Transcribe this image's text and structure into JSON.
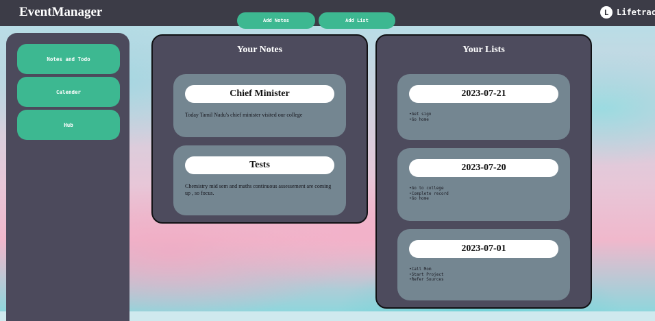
{
  "app": {
    "brand": "EventManager",
    "logo_mark": "L",
    "logo_text": "Lifetrack"
  },
  "toolbar": {
    "add_notes_label": "Add Notes",
    "add_list_label": "Add List"
  },
  "sidebar": {
    "items": [
      {
        "label": "Notes and Todo"
      },
      {
        "label": "Calender"
      },
      {
        "label": "Hub"
      }
    ]
  },
  "notes": {
    "title": "Your Notes",
    "items": [
      {
        "title": "Chief Minister",
        "body": "Today Tamil Nadu's chief minister visited our college"
      },
      {
        "title": "Tests",
        "body": "Chemistry mid sem and maths continuous assessement are coming up , so focus."
      }
    ]
  },
  "lists": {
    "title": "Your Lists",
    "items": [
      {
        "date": "2023-07-21",
        "entries": [
          "•Get sign",
          "•Go home"
        ]
      },
      {
        "date": "2023-07-20",
        "entries": [
          "•Go to college",
          "•Complete record",
          "•Go home"
        ]
      },
      {
        "date": "2023-07-01",
        "entries": [
          "•Call Mom",
          "•Start Project",
          "•Refer Sources"
        ]
      }
    ]
  },
  "colors": {
    "accent": "#3db891",
    "panel": "#4d4b5d",
    "card": "#748691",
    "topbar": "#3c3c47"
  }
}
